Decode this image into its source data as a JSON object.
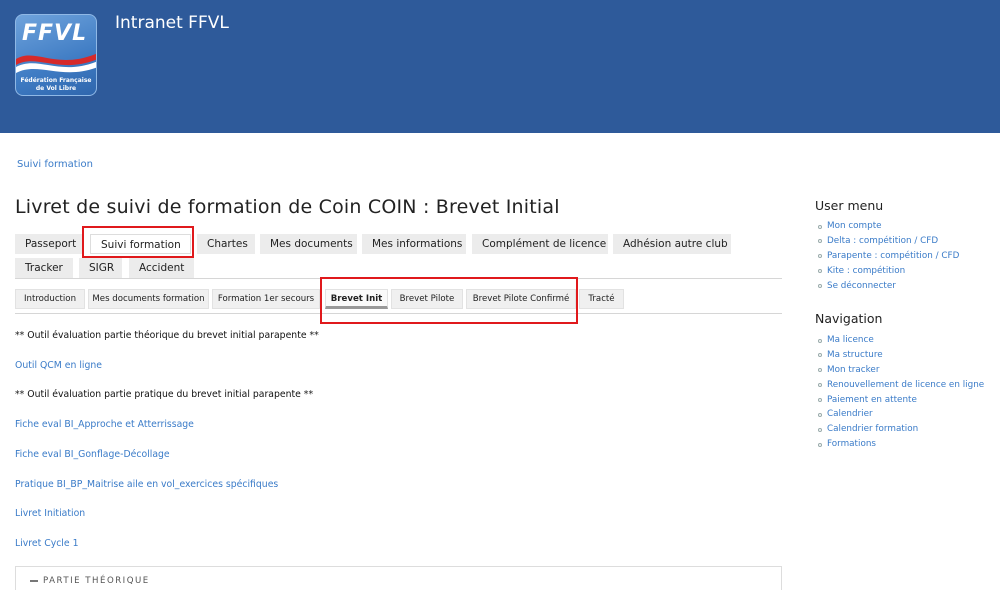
{
  "header": {
    "site_title": "Intranet FFVL",
    "logo": {
      "letters": "FFVL",
      "subtitle_line1": "Fédération Française",
      "subtitle_line2": "de Vol Libre",
      "accent": "#2e5a9a"
    }
  },
  "breadcrumb": "Suivi formation",
  "page_title": "Livret de suivi de formation de Coin COIN : Brevet Initial",
  "primary_tabs": [
    "Passeport",
    "Suivi formation",
    "Chartes",
    "Mes documents",
    "Mes informations",
    "Complément de licence",
    "Adhésion autre club",
    "Tracker",
    "SIGR",
    "Accident"
  ],
  "secondary_tabs": [
    "Introduction",
    "Mes documents formation",
    "Formation 1er secours",
    "Brevet Init",
    "Brevet Pilote",
    "Brevet Pilote Confirmé",
    "Tracté"
  ],
  "content": {
    "theory_heading": "** Outil évaluation partie théorique du brevet initial parapente **",
    "qcm_link": "Outil QCM en ligne",
    "practice_heading": "** Outil évaluation partie pratique du brevet initial parapente **",
    "links": [
      "Fiche eval BI_Approche et Atterrissage",
      "Fiche eval BI_Gonflage-Décollage",
      "Pratique BI_BP_Maitrise aile en vol_exercices spécifiques",
      "Livret Initiation",
      "Livret Cycle 1"
    ],
    "fieldset_legend": "PARTIE THÉORIQUE"
  },
  "sidebar": {
    "user_menu_title": "User menu",
    "user_menu": [
      "Mon compte",
      "Delta : compétition / CFD",
      "Parapente : compétition / CFD",
      "Kite : compétition",
      "Se déconnecter"
    ],
    "navigation_title": "Navigation",
    "navigation": [
      "Ma licence",
      "Ma structure",
      "Mon tracker",
      "Renouvellement de licence en ligne",
      "Paiement en attente",
      "Calendrier",
      "Calendrier formation",
      "Formations"
    ]
  },
  "colors": {
    "header_bg": "#2e5a9a",
    "link": "#3a7bc8",
    "highlight": "#e0191c"
  }
}
